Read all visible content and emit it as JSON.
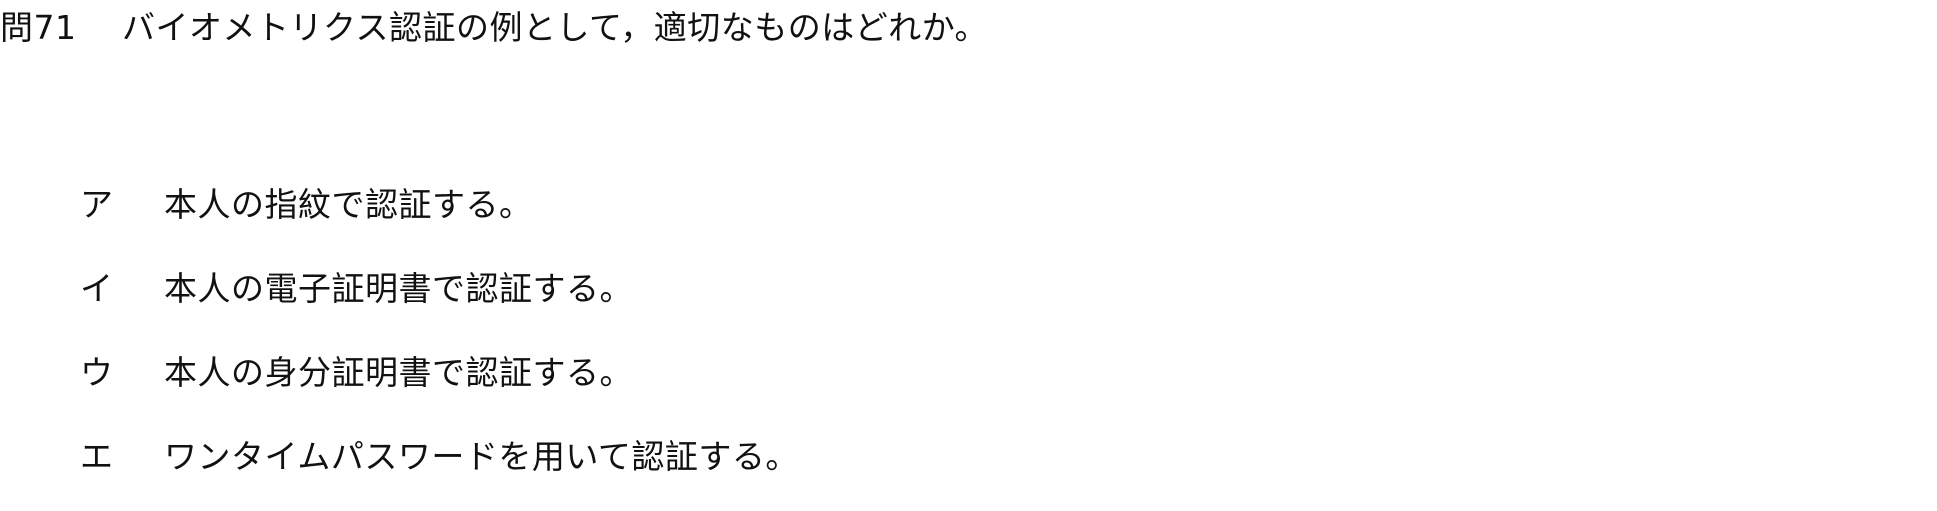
{
  "question": {
    "number": "問71",
    "text": "バイオメトリクス認証の例として，適切なものはどれか。"
  },
  "choices": [
    {
      "label": "ア",
      "text": "本人の指紋で認証する。"
    },
    {
      "label": "イ",
      "text": "本人の電子証明書で認証する。"
    },
    {
      "label": "ウ",
      "text": "本人の身分証明書で認証する。"
    },
    {
      "label": "エ",
      "text": "ワンタイムパスワードを用いて認証する。"
    }
  ]
}
